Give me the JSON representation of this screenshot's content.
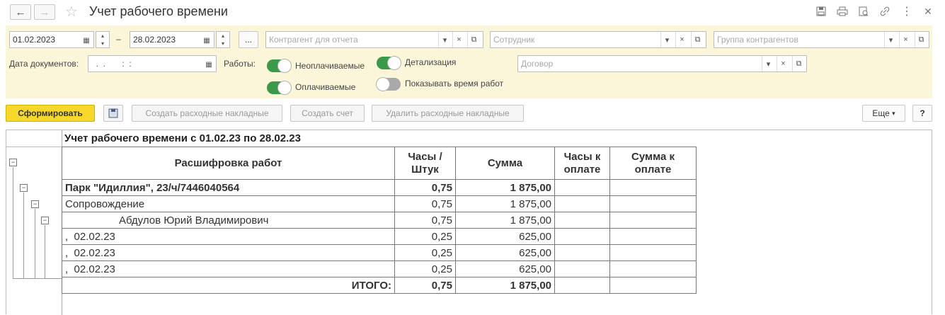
{
  "title": "Учет рабочего времени",
  "filters": {
    "date_from": "01.02.2023",
    "dash": "–",
    "date_to": "28.02.2023",
    "more_btn": "...",
    "counterparty_placeholder": "Контрагент для отчета",
    "employee_placeholder": "Сотрудник",
    "group_placeholder": "Группа контрагентов",
    "doc_date_label": "Дата документов:",
    "doc_date_value": "  .  .       :  :",
    "works_label": "Работы:",
    "unpaid_label": "Неоплачиваемые",
    "paid_label": "Оплачиваемые",
    "detail_label": "Детализация",
    "show_time_label": "Показывать время работ",
    "contract_placeholder": "Договор"
  },
  "toolbar": {
    "generate": "Сформировать",
    "create_invoices": "Создать расходные накладные",
    "create_bill": "Создать счет",
    "delete_invoices": "Удалить расходные накладные",
    "more": "Еще",
    "help": "?"
  },
  "report": {
    "heading": "Учет рабочего времени с 01.02.23 по 28.02.23",
    "columns": [
      "Расшифровка работ",
      "Часы / Штук",
      "Сумма",
      "Часы к оплате",
      "Сумма к оплате"
    ],
    "rows": [
      {
        "name": "Парк \"Идиллия\", 23/ч/7446040564",
        "hours": "0,75",
        "sum": "1 875,00",
        "bold": true
      },
      {
        "name": "Сопровождение",
        "hours": "0,75",
        "sum": "1 875,00"
      },
      {
        "name": "Абдулов Юрий Владимирович",
        "hours": "0,75",
        "sum": "1 875,00",
        "indent": true
      },
      {
        "name": ",  02.02.23",
        "hours": "0,25",
        "sum": "625,00"
      },
      {
        "name": ",  02.02.23",
        "hours": "0,25",
        "sum": "625,00"
      },
      {
        "name": ",  02.02.23",
        "hours": "0,25",
        "sum": "625,00"
      }
    ],
    "total_label": "ИТОГО:",
    "total_hours": "0,75",
    "total_sum": "1 875,00"
  }
}
